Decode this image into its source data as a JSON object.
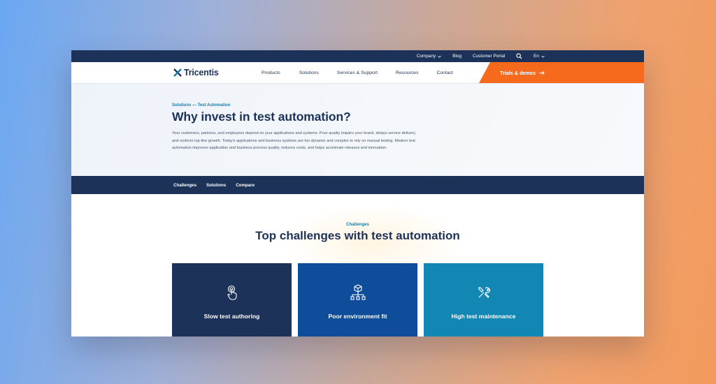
{
  "utility_bar": {
    "company": "Company",
    "blog": "Blog",
    "customer_portal": "Customer Portal",
    "language": "En"
  },
  "nav": {
    "logo": "Tricentis",
    "items": [
      "Products",
      "Solutions",
      "Services & Support",
      "Resources",
      "Contact"
    ],
    "cta": "Trials & demos"
  },
  "hero": {
    "eyebrow": "Solutions — Test Automation",
    "title": "Why invest in test automation?",
    "description": "Your customers, partners, and employees depend on your applications and systems. Poor quality impairs your brand, delays service delivery, and restricts top-line growth. Today's applications and business systems are too dynamic and complex to rely on manual testing. Modern test automation improves application and business process quality, reduces costs, and helps accelerate releases and innovation."
  },
  "sub_nav": [
    "Challenges",
    "Solutions",
    "Compare"
  ],
  "challenges": {
    "eyebrow": "Challenges",
    "title": "Top challenges with test automation",
    "cards": [
      {
        "label": "Slow test authoring",
        "icon": "touch-icon"
      },
      {
        "label": "Poor environment fit",
        "icon": "network-icon"
      },
      {
        "label": "High test maintenance",
        "icon": "tools-icon"
      }
    ]
  },
  "colors": {
    "navy": "#1c3258",
    "blue": "#0f4c99",
    "teal": "#1287b3",
    "orange": "#f56a1c",
    "accent_text": "#1a7aa8"
  }
}
